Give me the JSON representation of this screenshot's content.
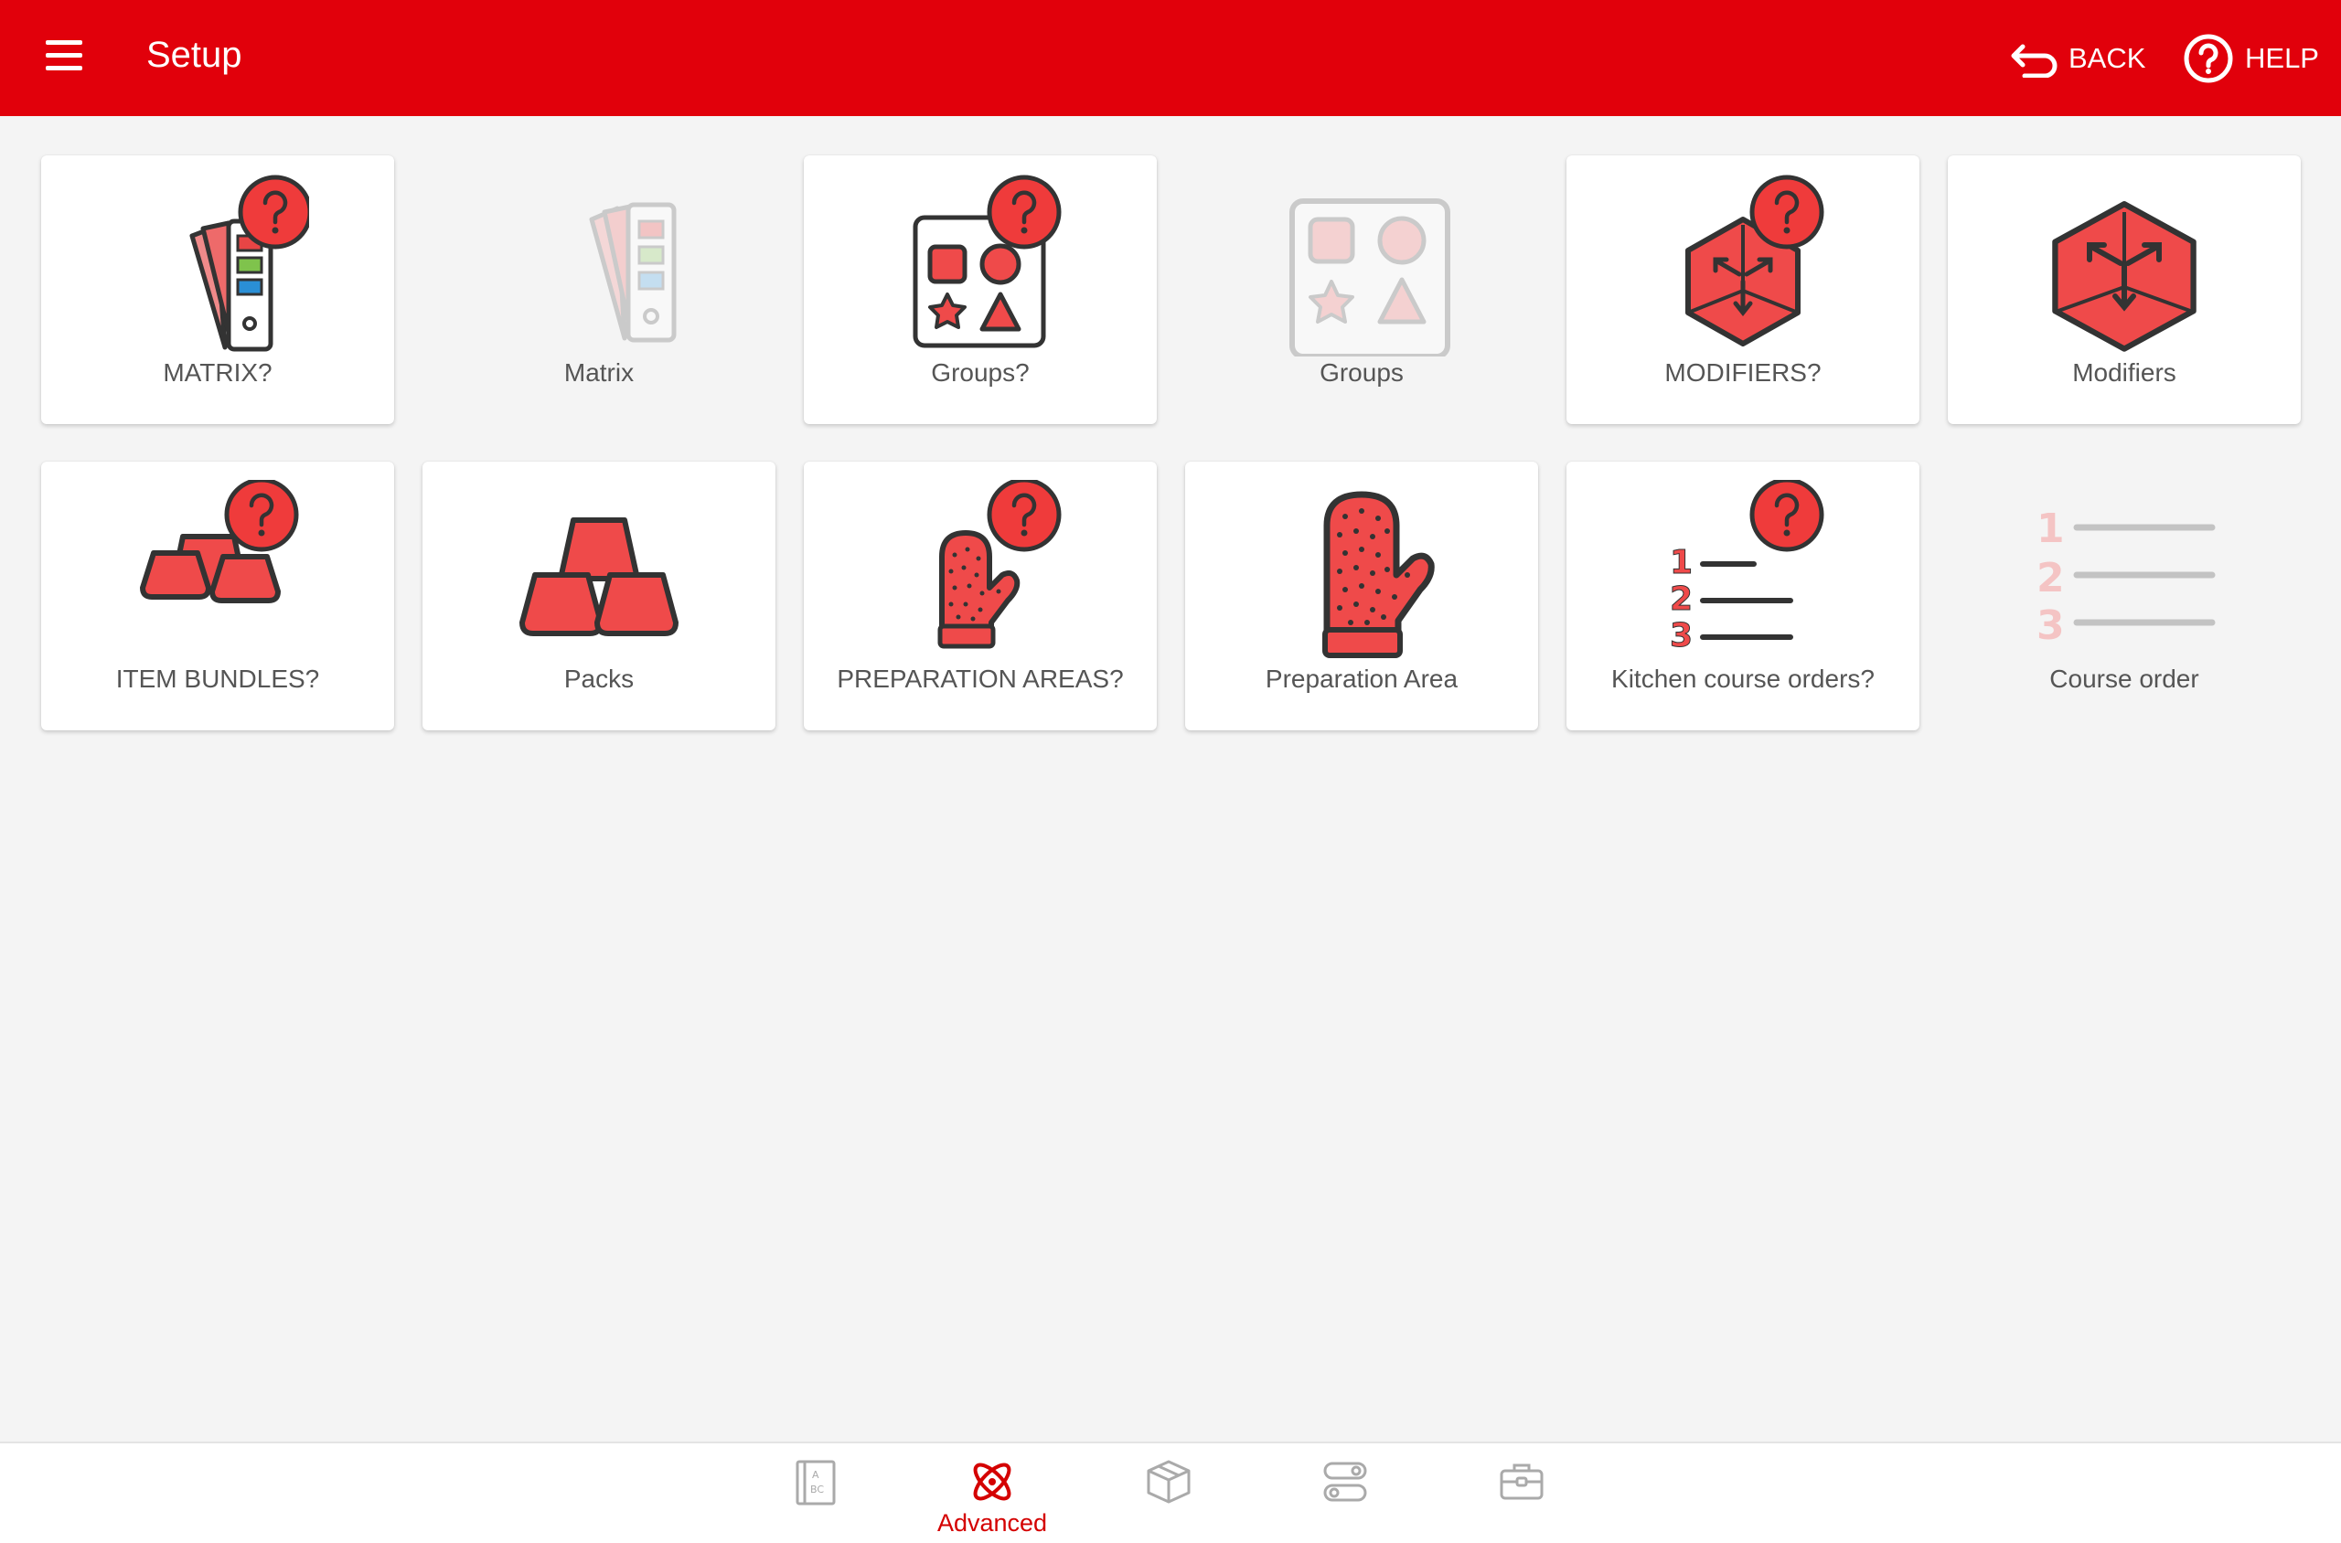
{
  "header": {
    "title": "Setup",
    "back_label": "BACK",
    "help_label": "HELP"
  },
  "tiles": [
    {
      "label": "MATRIX?",
      "icon": "matrix-question-icon",
      "enabled": true
    },
    {
      "label": "Matrix",
      "icon": "matrix-icon",
      "enabled": false
    },
    {
      "label": "Groups?",
      "icon": "groups-question-icon",
      "enabled": true
    },
    {
      "label": "Groups",
      "icon": "groups-icon",
      "enabled": false
    },
    {
      "label": "MODIFIERS?",
      "icon": "modifiers-question-icon",
      "enabled": true
    },
    {
      "label": "Modifiers",
      "icon": "modifiers-icon",
      "enabled": true
    },
    {
      "label": "ITEM BUNDLES?",
      "icon": "bundles-question-icon",
      "enabled": true
    },
    {
      "label": "Packs",
      "icon": "packs-icon",
      "enabled": true
    },
    {
      "label": "PREPARATION AREAS?",
      "icon": "preparation-question-icon",
      "enabled": true
    },
    {
      "label": "Preparation Area",
      "icon": "oven-mitt-icon",
      "enabled": true
    },
    {
      "label": "Kitchen course orders?",
      "icon": "course-question-icon",
      "enabled": true
    },
    {
      "label": "Course order",
      "icon": "course-order-icon",
      "enabled": false
    }
  ],
  "bottom_nav": [
    {
      "icon": "catalog-abc-icon",
      "label": "",
      "active": false
    },
    {
      "icon": "atom-icon",
      "label": "Advanced",
      "active": true
    },
    {
      "icon": "box-icon",
      "label": "",
      "active": false
    },
    {
      "icon": "toggles-icon",
      "label": "",
      "active": false
    },
    {
      "icon": "toolbox-icon",
      "label": "",
      "active": false
    }
  ],
  "colors": {
    "brand": "#e1000b",
    "icon_red": "#ef4a4a",
    "icon_outline": "#333333",
    "disabled": "#c8c8c8",
    "background": "#f4f4f4"
  }
}
